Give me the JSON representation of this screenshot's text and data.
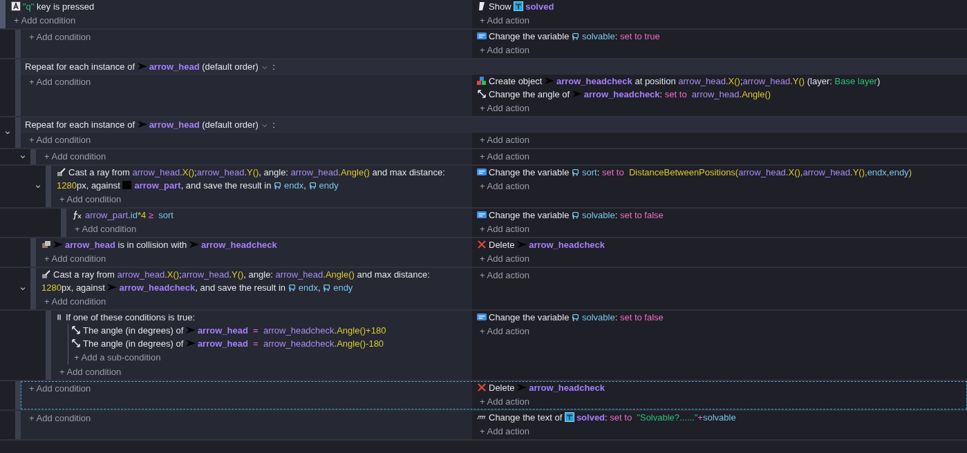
{
  "events": [
    {
      "selected": false,
      "add_condition": "+ Add condition",
      "add_action": "+ Add action",
      "conditions": [
        {
          "kind": "key-pressed",
          "segments": [
            {
              "kind": "string",
              "text": "\"q\""
            },
            {
              "kind": "plain",
              "text": " key is pressed"
            }
          ]
        }
      ],
      "actions": [
        {
          "kind": "show",
          "segments": [
            {
              "kind": "plain",
              "text": "Show "
            },
            {
              "kind": "text-object-ref"
            },
            {
              "kind": "object",
              "text": "solved"
            }
          ]
        }
      ],
      "children": [
        {
          "selected": false,
          "add_condition": "+ Add condition",
          "add_action": "+ Add action",
          "actions": [
            {
              "kind": "set-variable",
              "segments": [
                {
                  "kind": "plain",
                  "text": "Change the variable "
                },
                {
                  "kind": "variable-ref"
                },
                {
                  "kind": "var",
                  "text": "solvable"
                },
                {
                  "kind": "plain",
                  "text": ": "
                },
                {
                  "kind": "op",
                  "text": "set to true"
                }
              ]
            }
          ]
        },
        {
          "selected": false,
          "add_condition": "+ Add condition",
          "add_action": "+ Add action",
          "header": [
            {
              "kind": "plain",
              "text": "Repeat for each instance of "
            },
            {
              "kind": "sprite-ref"
            },
            {
              "kind": "object",
              "text": "arrow_head"
            },
            {
              "kind": "plain",
              "text": "  (default order)  "
            },
            {
              "kind": "dropdown"
            },
            {
              "kind": "plain",
              "text": " :"
            }
          ],
          "actions": [
            {
              "kind": "create",
              "segments": [
                {
                  "kind": "plain",
                  "text": "Create object "
                },
                {
                  "kind": "sprite-ref"
                },
                {
                  "kind": "object",
                  "text": "arrow_headcheck"
                },
                {
                  "kind": "plain",
                  "text": " at position "
                },
                {
                  "kind": "expr",
                  "text": "arrow_head"
                },
                {
                  "kind": "fn",
                  "text": ".X()"
                },
                {
                  "kind": "plain",
                  "text": ";"
                },
                {
                  "kind": "expr",
                  "text": "arrow_head"
                },
                {
                  "kind": "fn",
                  "text": ".Y()"
                },
                {
                  "kind": "plain",
                  "text": " (layer: "
                },
                {
                  "kind": "string",
                  "text": "Base layer"
                },
                {
                  "kind": "plain",
                  "text": ")"
                }
              ]
            },
            {
              "kind": "set-angle",
              "segments": [
                {
                  "kind": "plain",
                  "text": "Change the angle of "
                },
                {
                  "kind": "sprite-ref"
                },
                {
                  "kind": "object",
                  "text": "arrow_headcheck"
                },
                {
                  "kind": "plain",
                  "text": ": "
                },
                {
                  "kind": "op",
                  "text": "set to  "
                },
                {
                  "kind": "expr",
                  "text": "arrow_head"
                },
                {
                  "kind": "fn",
                  "text": ".Angle()"
                }
              ]
            }
          ]
        },
        {
          "selected": false,
          "expanded": true,
          "add_condition": "+ Add condition",
          "add_action": "+ Add action",
          "header": [
            {
              "kind": "plain",
              "text": "Repeat for each instance of "
            },
            {
              "kind": "sprite-ref"
            },
            {
              "kind": "object",
              "text": "arrow_head"
            },
            {
              "kind": "plain",
              "text": "  (default order)  "
            },
            {
              "kind": "dropdown"
            },
            {
              "kind": "plain",
              "text": " :"
            }
          ],
          "children": [
            {
              "selected": false,
              "expanded": true,
              "add_condition": "+ Add condition",
              "add_action": "+ Add action",
              "children": [
                {
                  "selected": false,
                  "expanded": true,
                  "add_condition": "+ Add condition",
                  "add_action": "+ Add action",
                  "conditions": [
                    {
                      "kind": "raycast",
                      "segments": [
                        {
                          "kind": "plain",
                          "text": "Cast a ray from "
                        },
                        {
                          "kind": "expr",
                          "text": "arrow_head"
                        },
                        {
                          "kind": "fn",
                          "text": ".X()"
                        },
                        {
                          "kind": "plain",
                          "text": ";"
                        },
                        {
                          "kind": "expr",
                          "text": "arrow_head"
                        },
                        {
                          "kind": "fn",
                          "text": ".Y()"
                        },
                        {
                          "kind": "plain",
                          "text": ", angle: "
                        },
                        {
                          "kind": "expr",
                          "text": "arrow_head"
                        },
                        {
                          "kind": "fn",
                          "text": ".Angle()"
                        },
                        {
                          "kind": "plain",
                          "text": " and max distance: "
                        },
                        {
                          "kind": "fn",
                          "text": "1280"
                        },
                        {
                          "kind": "plain",
                          "text": "px, against "
                        },
                        {
                          "kind": "square-ref"
                        },
                        {
                          "kind": "object",
                          "text": "arrow_part"
                        },
                        {
                          "kind": "plain",
                          "text": ", and save the result in "
                        },
                        {
                          "kind": "variable-ref"
                        },
                        {
                          "kind": "var",
                          "text": "endx"
                        },
                        {
                          "kind": "plain",
                          "text": ", "
                        },
                        {
                          "kind": "variable-ref"
                        },
                        {
                          "kind": "var",
                          "text": "endy"
                        }
                      ]
                    }
                  ],
                  "actions": [
                    {
                      "kind": "set-variable",
                      "segments": [
                        {
                          "kind": "plain",
                          "text": "Change the variable "
                        },
                        {
                          "kind": "variable-ref"
                        },
                        {
                          "kind": "var",
                          "text": "sort"
                        },
                        {
                          "kind": "plain",
                          "text": ": "
                        },
                        {
                          "kind": "op",
                          "text": "set to  "
                        },
                        {
                          "kind": "fn",
                          "text": "DistanceBetweenPositions("
                        },
                        {
                          "kind": "expr",
                          "text": "arrow_head"
                        },
                        {
                          "kind": "fn",
                          "text": ".X(),"
                        },
                        {
                          "kind": "expr",
                          "text": "arrow_head"
                        },
                        {
                          "kind": "fn",
                          "text": ".Y(),"
                        },
                        {
                          "kind": "var",
                          "text": "endx"
                        },
                        {
                          "kind": "fn",
                          "text": ","
                        },
                        {
                          "kind": "var",
                          "text": "endy"
                        },
                        {
                          "kind": "fn",
                          "text": ")"
                        }
                      ]
                    }
                  ],
                  "children": [
                    {
                      "selected": false,
                      "add_condition": "+ Add condition",
                      "add_action": "+ Add action",
                      "conditions": [
                        {
                          "kind": "compare",
                          "segments": [
                            {
                              "kind": "expr",
                              "text": "arrow_part"
                            },
                            {
                              "kind": "var",
                              "text": ".id"
                            },
                            {
                              "kind": "fn",
                              "text": "*4"
                            },
                            {
                              "kind": "op",
                              "text": " ≥  "
                            },
                            {
                              "kind": "var",
                              "text": "sort"
                            }
                          ]
                        }
                      ],
                      "actions": [
                        {
                          "kind": "set-variable",
                          "segments": [
                            {
                              "kind": "plain",
                              "text": "Change the variable "
                            },
                            {
                              "kind": "variable-ref"
                            },
                            {
                              "kind": "var",
                              "text": "solvable"
                            },
                            {
                              "kind": "plain",
                              "text": ": "
                            },
                            {
                              "kind": "op",
                              "text": "set to false"
                            }
                          ]
                        }
                      ]
                    }
                  ]
                }
              ]
            },
            {
              "selected": false,
              "add_condition": "+ Add condition",
              "add_action": "+ Add action",
              "conditions": [
                {
                  "kind": "collision",
                  "segments": [
                    {
                      "kind": "sprite-ref"
                    },
                    {
                      "kind": "object",
                      "text": "arrow_head"
                    },
                    {
                      "kind": "plain",
                      "text": " is in collision with "
                    },
                    {
                      "kind": "sprite-ref"
                    },
                    {
                      "kind": "object",
                      "text": "arrow_headcheck"
                    }
                  ]
                }
              ],
              "actions": [
                {
                  "kind": "delete",
                  "segments": [
                    {
                      "kind": "plain",
                      "text": "Delete "
                    },
                    {
                      "kind": "sprite-ref"
                    },
                    {
                      "kind": "object",
                      "text": "arrow_headcheck"
                    }
                  ]
                }
              ]
            },
            {
              "selected": false,
              "expanded": true,
              "add_condition": "+ Add condition",
              "add_action": "+ Add action",
              "conditions": [
                {
                  "kind": "raycast",
                  "segments": [
                    {
                      "kind": "plain",
                      "text": "Cast a ray from "
                    },
                    {
                      "kind": "expr",
                      "text": "arrow_head"
                    },
                    {
                      "kind": "fn",
                      "text": ".X()"
                    },
                    {
                      "kind": "plain",
                      "text": ";"
                    },
                    {
                      "kind": "expr",
                      "text": "arrow_head"
                    },
                    {
                      "kind": "fn",
                      "text": ".Y()"
                    },
                    {
                      "kind": "plain",
                      "text": ", angle: "
                    },
                    {
                      "kind": "expr",
                      "text": "arrow_head"
                    },
                    {
                      "kind": "fn",
                      "text": ".Angle()"
                    },
                    {
                      "kind": "plain",
                      "text": " and max distance: "
                    },
                    {
                      "kind": "fn",
                      "text": "1280"
                    },
                    {
                      "kind": "plain",
                      "text": "px,"
                    },
                    {
                      "kind": "plain",
                      "text": " against "
                    },
                    {
                      "kind": "sprite-ref"
                    },
                    {
                      "kind": "object",
                      "text": "arrow_headcheck"
                    },
                    {
                      "kind": "plain",
                      "text": ", and save the result in "
                    },
                    {
                      "kind": "variable-ref"
                    },
                    {
                      "kind": "var",
                      "text": "endx"
                    },
                    {
                      "kind": "plain",
                      "text": ", "
                    },
                    {
                      "kind": "variable-ref"
                    },
                    {
                      "kind": "var",
                      "text": "endy"
                    }
                  ]
                }
              ],
              "children": [
                {
                  "selected": false,
                  "add_condition": "+ Add condition",
                  "add_action": "+ Add action",
                  "conditions": [
                    {
                      "kind": "or",
                      "segments": [
                        {
                          "kind": "plain",
                          "text": "If one of these conditions is true:"
                        }
                      ],
                      "add_sub_condition": "+ Add a sub-condition",
                      "sub_conditions": [
                        {
                          "kind": "set-angle",
                          "segments": [
                            {
                              "kind": "plain",
                              "text": "The angle (in degrees) of "
                            },
                            {
                              "kind": "sprite-ref"
                            },
                            {
                              "kind": "object",
                              "text": "arrow_head"
                            },
                            {
                              "kind": "op",
                              "text": "  =  "
                            },
                            {
                              "kind": "expr",
                              "text": "arrow_headcheck"
                            },
                            {
                              "kind": "fn",
                              "text": ".Angle()+180"
                            }
                          ]
                        },
                        {
                          "kind": "set-angle",
                          "segments": [
                            {
                              "kind": "plain",
                              "text": "The angle (in degrees) of "
                            },
                            {
                              "kind": "sprite-ref"
                            },
                            {
                              "kind": "object",
                              "text": "arrow_head"
                            },
                            {
                              "kind": "op",
                              "text": "  =  "
                            },
                            {
                              "kind": "expr",
                              "text": "arrow_headcheck"
                            },
                            {
                              "kind": "fn",
                              "text": ".Angle()-180"
                            }
                          ]
                        }
                      ]
                    }
                  ],
                  "actions": [
                    {
                      "kind": "set-variable",
                      "segments": [
                        {
                          "kind": "plain",
                          "text": "Change the variable "
                        },
                        {
                          "kind": "variable-ref"
                        },
                        {
                          "kind": "var",
                          "text": "solvable"
                        },
                        {
                          "kind": "plain",
                          "text": ": "
                        },
                        {
                          "kind": "op",
                          "text": "set to false"
                        }
                      ]
                    }
                  ]
                }
              ]
            }
          ]
        },
        {
          "selected": true,
          "add_condition": "+ Add condition",
          "add_action": "+ Add action",
          "actions": [
            {
              "kind": "delete",
              "segments": [
                {
                  "kind": "plain",
                  "text": "Delete "
                },
                {
                  "kind": "sprite-ref"
                },
                {
                  "kind": "object",
                  "text": "arrow_headcheck"
                }
              ]
            }
          ]
        },
        {
          "selected": false,
          "add_condition": "+ Add condition",
          "add_action": "+ Add action",
          "actions": [
            {
              "kind": "set-text",
              "segments": [
                {
                  "kind": "plain",
                  "text": "Change the text of "
                },
                {
                  "kind": "text-object-ref"
                },
                {
                  "kind": "object",
                  "text": "solved"
                },
                {
                  "kind": "plain",
                  "text": ": "
                },
                {
                  "kind": "op",
                  "text": "set to  "
                },
                {
                  "kind": "string",
                  "text": "\"Solvable?......\""
                },
                {
                  "kind": "op",
                  "text": "+"
                },
                {
                  "kind": "var",
                  "text": "solvable"
                }
              ]
            }
          ]
        }
      ]
    }
  ]
}
